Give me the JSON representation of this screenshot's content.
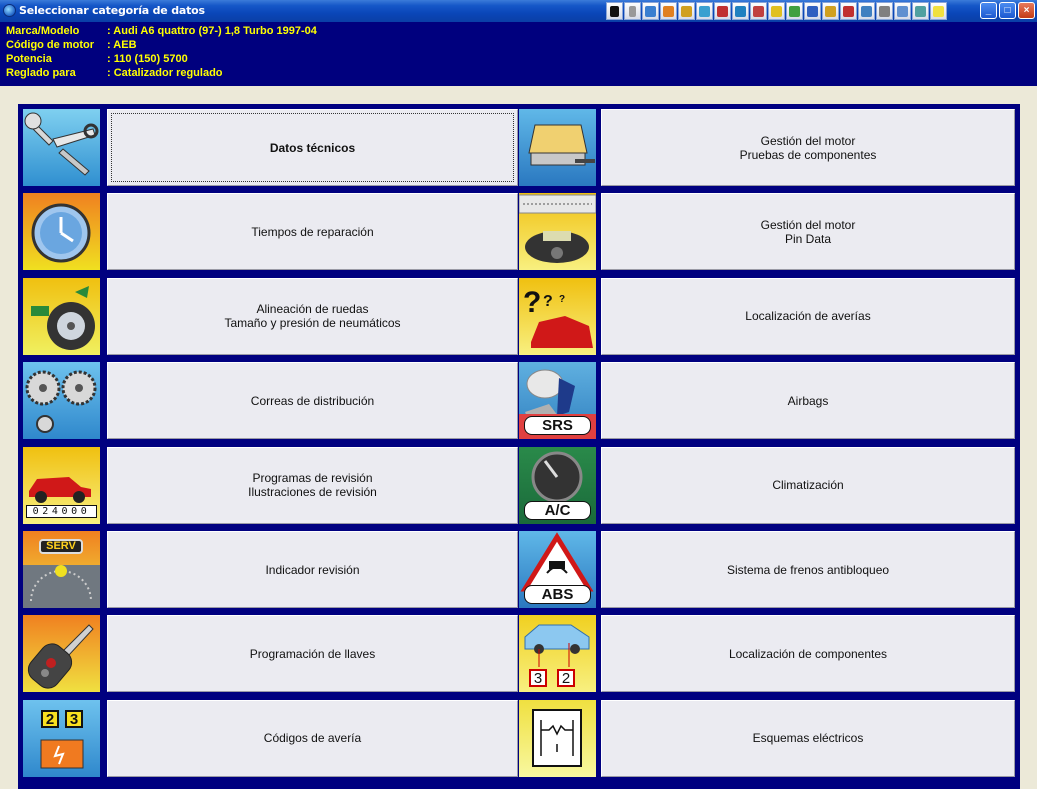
{
  "window": {
    "title": "Seleccionar categoría de datos",
    "toolbar_icons": [
      "first-page-icon",
      "prev-icon",
      "chart-icon",
      "engine-icon",
      "hand-icon",
      "question-icon",
      "print-icon",
      "book-icon",
      "wrench-icon",
      "battery-icon",
      "disk-icon",
      "screen-icon",
      "tools-icon",
      "car-icon",
      "phone-icon",
      "shield-icon",
      "user-icon",
      "doc-icon",
      "help-icon"
    ],
    "controls": {
      "minimize": "_",
      "maximize": "□",
      "close": "×"
    }
  },
  "vehicle": {
    "rows": [
      {
        "label": "Marca/Modelo",
        "value": ": Audi   A6 quattro (97-) 1,8 Turbo 1997-04"
      },
      {
        "label": "Código de motor",
        "value": ": AEB"
      },
      {
        "label": "Potencia",
        "value": ": 110 (150) 5700"
      },
      {
        "label": "Reglado para",
        "value": ": Catalizador regulado"
      }
    ]
  },
  "categories": {
    "left": [
      {
        "icon": "wrench-spanner-icon",
        "label": "Datos técnicos"
      },
      {
        "icon": "clock-icon",
        "label": "Tiempos de reparación"
      },
      {
        "icon": "wheel-alignment-icon",
        "label": "Alineación de ruedas\nTamaño y presión de neumáticos"
      },
      {
        "icon": "timing-belt-icon",
        "label": "Correas de distribución"
      },
      {
        "icon": "service-schedule-icon",
        "label": "Programas de revisión\nIlustraciones de revisión",
        "odometer": "024000"
      },
      {
        "icon": "service-indicator-icon",
        "label": "Indicador revisión",
        "badge": "SERV"
      },
      {
        "icon": "car-key-icon",
        "label": "Programación de llaves"
      },
      {
        "icon": "fault-codes-icon",
        "label": "Códigos de avería",
        "digits": [
          "2",
          "3"
        ]
      }
    ],
    "right": [
      {
        "icon": "ecu-test-icon",
        "label": "Gestión del motor\nPruebas de componentes"
      },
      {
        "icon": "multimeter-icon",
        "label": "Gestión del motor\nPin Data"
      },
      {
        "icon": "fault-finding-icon",
        "label": "Localización de averías"
      },
      {
        "icon": "airbag-icon",
        "label": "Airbags",
        "badge": "SRS"
      },
      {
        "icon": "air-conditioning-icon",
        "label": "Climatización",
        "badge": "A/C"
      },
      {
        "icon": "abs-warning-icon",
        "label": "Sistema de frenos antibloqueo",
        "badge": "ABS"
      },
      {
        "icon": "component-location-icon",
        "label": "Localización de componentes",
        "digits": [
          "3",
          "2"
        ]
      },
      {
        "icon": "wiring-diagram-icon",
        "label": "Esquemas eléctricos"
      }
    ]
  },
  "colors": {
    "panel": "#00007e",
    "info_text": "#ffff00",
    "grid_bg": "#000080",
    "button_face": "#ebebf1"
  }
}
